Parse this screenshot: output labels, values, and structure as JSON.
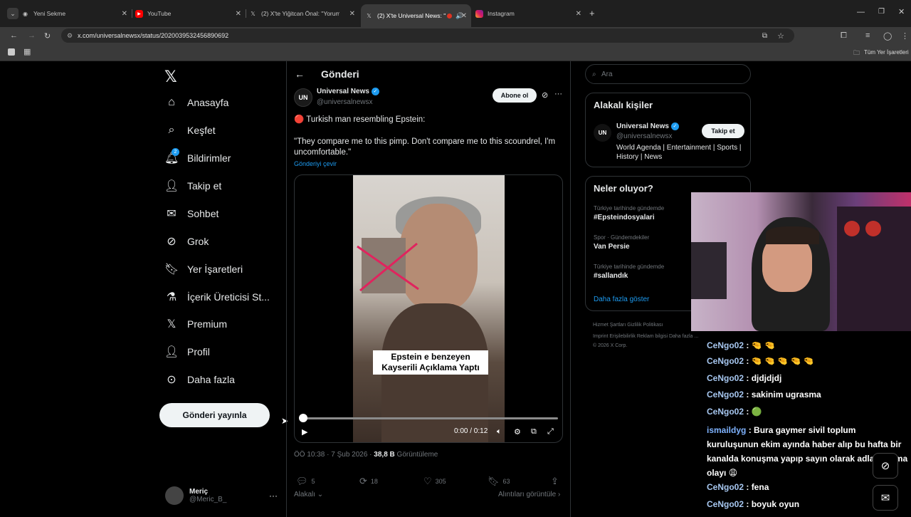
{
  "browser": {
    "tabs": [
      {
        "title": "Yeni Sekme",
        "icon": "chrome-icon"
      },
      {
        "title": "YouTube",
        "icon": "youtube-icon"
      },
      {
        "title": "(2) X'te Yiğitcan Önal: \"Yorumla",
        "icon": "x-icon"
      },
      {
        "title": "(2) X'te Universal News: \"",
        "icon": "x-icon"
      },
      {
        "title": "Instagram",
        "icon": "instagram-icon"
      }
    ],
    "url": "x.com/universalnewsx/status/2020039532456890692",
    "bookmarks_label": "Tüm Yer İşaretleri"
  },
  "sidebar": {
    "items": [
      {
        "label": "Anasayfa",
        "icon": "home-icon"
      },
      {
        "label": "Keşfet",
        "icon": "search-icon"
      },
      {
        "label": "Bildirimler",
        "icon": "bell-icon",
        "badge": "2"
      },
      {
        "label": "Takip et",
        "icon": "follow-icon"
      },
      {
        "label": "Sohbet",
        "icon": "mail-icon"
      },
      {
        "label": "Grok",
        "icon": "grok-icon"
      },
      {
        "label": "Yer İşaretleri",
        "icon": "bookmark-icon"
      },
      {
        "label": "İçerik Üreticisi St...",
        "icon": "flask-icon"
      },
      {
        "label": "Premium",
        "icon": "x-icon"
      },
      {
        "label": "Profil",
        "icon": "profile-icon"
      },
      {
        "label": "Daha fazla",
        "icon": "more-circle-icon"
      }
    ],
    "post_button": "Gönderi yayınla",
    "user": {
      "name": "Meriç",
      "handle": "@Meric_B_"
    }
  },
  "main": {
    "title": "Gönderi",
    "tweet": {
      "avatar_text": "UN",
      "name": "Universal News",
      "handle": "@universalnewsx",
      "subscribe": "Abone ol",
      "line1": "🔴 Turkish man resembling Epstein:",
      "quote": "\"They compare me to this pimp. Don't compare me to this scoundrel, I'm uncomfortable.\"",
      "translate": "Gönderiyi çevir",
      "video_caption_1": "Epstein e benzeyen",
      "video_caption_2": "Kayserili Açıklama Yaptı",
      "video_time": "0:00 / 0:12",
      "timestamp": "ÖÖ 10:38 · 7 Şub 2026 · ",
      "views": "38,8 B",
      "views_label": " Görüntüleme",
      "replies": "5",
      "reposts": "18",
      "likes": "305",
      "bookmarks": "63",
      "relevant": "Alakalı",
      "quotes": "Alıntıları görüntüle"
    }
  },
  "right": {
    "search_placeholder": "Ara",
    "related": {
      "title": "Alakalı kişiler",
      "name": "Universal News",
      "handle": "@universalnewsx",
      "follow": "Takip et",
      "bio": "World Agenda | Entertainment | Sports | History | News"
    },
    "trends": {
      "title": "Neler oluyor?",
      "items": [
        {
          "category": "Türkiye tarihinde gündemde",
          "name": "#Epsteindosyalari"
        },
        {
          "category": "Spor · Gündemdekiler",
          "name": "Van Persie"
        },
        {
          "category": "Türkiye tarihinde gündemde",
          "name": "#sallandık"
        }
      ],
      "more": "Daha fazla göster"
    },
    "footer_1": "Hizmet Şartları   Gizlilik Politikası",
    "footer_2": "Imprint   Erişilebilirlik   Reklam bilgisi   Daha fazla ...",
    "footer_3": "© 2026 X Corp."
  },
  "chat": [
    {
      "user": "CeNgo02",
      "msg": ": 🤏 🤏"
    },
    {
      "user": "CeNgo02",
      "msg": ": 🤏 🤏 🤏 🤏 🤏"
    },
    {
      "user": "CeNgo02",
      "msg": ": djdjdjdj"
    },
    {
      "user": "CeNgo02",
      "msg": ": sakinim ugrasma"
    },
    {
      "user": "CeNgo02",
      "msg": ": 🟢"
    },
    {
      "user": "ismaildyg",
      "msg": ": Bura gaymer sivil toplum kuruluşunun ekim ayında haber alıp bu hafta bir kanalda konuşma yapıp sayın olarak adlandırılma olayı 😩"
    },
    {
      "user": "CeNgo02",
      "msg": ": fena"
    },
    {
      "user": "CeNgo02",
      "msg": ": boyuk oyun"
    }
  ]
}
